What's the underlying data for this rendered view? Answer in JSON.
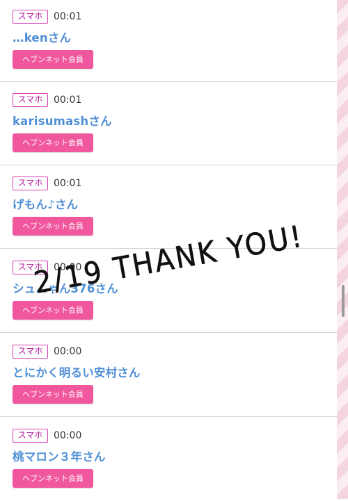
{
  "entries": [
    {
      "badge": "スマホ",
      "time": "00:01",
      "name": "…kenさん",
      "button": "ヘブンネット会員"
    },
    {
      "badge": "スマホ",
      "time": "00:01",
      "name": "karisumashさん",
      "button": "ヘブンネット会員"
    },
    {
      "badge": "スマホ",
      "time": "00:01",
      "name": "げもん♪さん",
      "button": "ヘブンネット会員"
    },
    {
      "badge": "スマホ",
      "time": "00:00",
      "name": "シュ…ゃん376さん",
      "button": "ヘブンネット会員"
    },
    {
      "badge": "スマホ",
      "time": "00:00",
      "name": "とにかく明るい安村さん",
      "button": "ヘブンネット会員"
    },
    {
      "badge": "スマホ",
      "time": "00:00",
      "name": "桃マロン３年さん",
      "button": "ヘブンネット会員"
    }
  ],
  "overlay": {
    "text": "2/19 THANK YOU!"
  },
  "colors": {
    "badge_border": "#d63cb5",
    "name": "#4f8fd6",
    "button": "#f0579d"
  }
}
